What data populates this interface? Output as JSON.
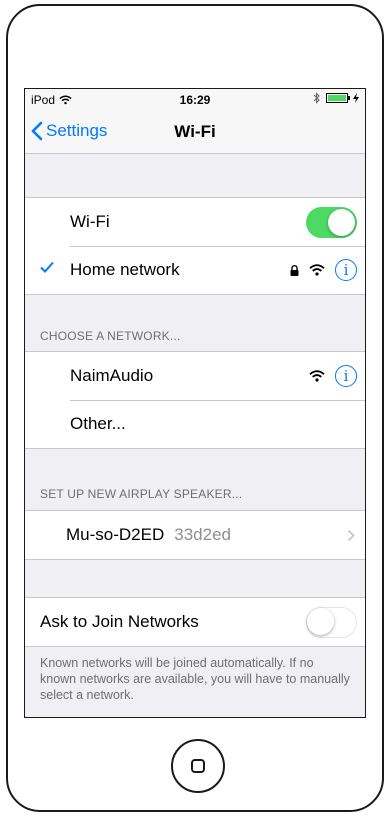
{
  "status_bar": {
    "carrier": "iPod",
    "time": "16:29"
  },
  "nav": {
    "back_label": "Settings",
    "title": "Wi-Fi"
  },
  "wifi_group": {
    "toggle_label": "Wi-Fi",
    "toggle_on": true,
    "connected_network": "Home network"
  },
  "choose_network": {
    "header": "CHOOSE A NETWORK...",
    "networks": [
      {
        "name": "NaimAudio"
      },
      {
        "name": "Other..."
      }
    ]
  },
  "airplay": {
    "header": "SET UP NEW AIRPLAY SPEAKER...",
    "speaker_name": "Mu-so-D2ED",
    "speaker_id": "33d2ed"
  },
  "ask_join": {
    "label": "Ask to Join Networks",
    "toggle_on": false,
    "footer": "Known networks will be joined automatically. If no known networks are available, you will have to manually select a network."
  },
  "icons": {
    "info_glyph": "i"
  },
  "colors": {
    "accent": "#007aff",
    "toggle_on": "#4cd964",
    "background": "#efeff4",
    "separator": "#c8c7cc"
  }
}
